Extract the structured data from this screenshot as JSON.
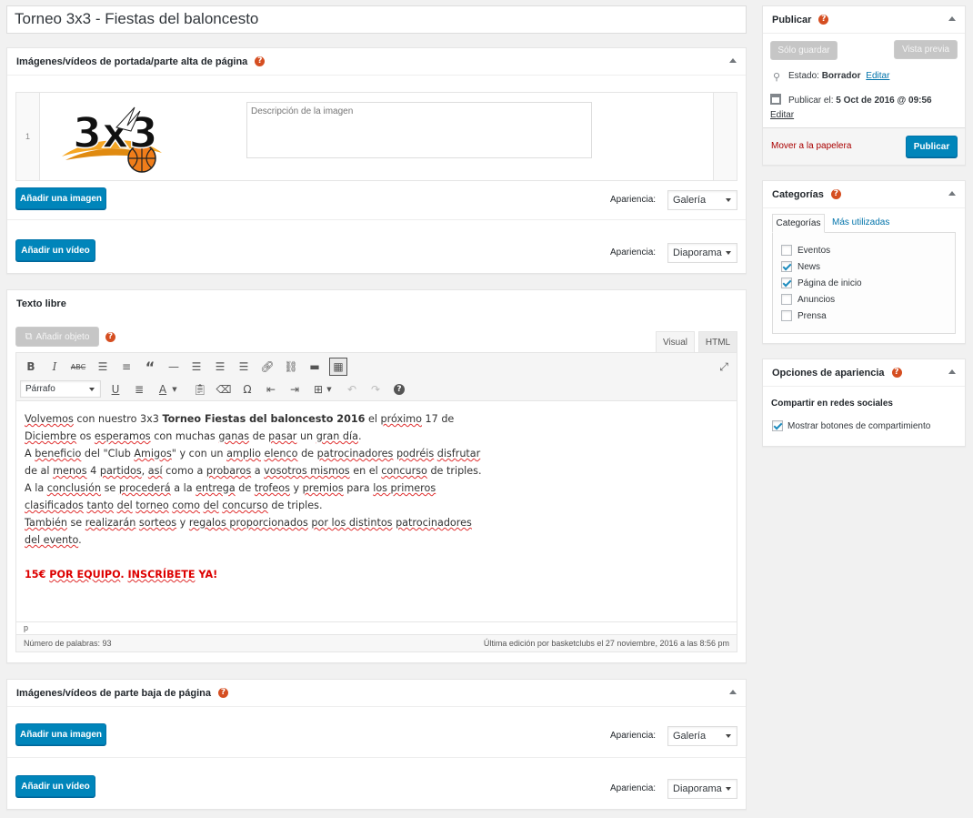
{
  "post_title": "Torneo 3x3 - Fiestas del baloncesto",
  "top_media": {
    "title": "Imágenes/vídeos de portada/parte alta de página",
    "row_number": "1",
    "logo_text": "3x3",
    "description_placeholder": "Descripción de la imagen",
    "add_image_label": "Añadir una imagen",
    "appearance_label": "Apariencia:",
    "image_appearance": "Galería",
    "add_video_label": "Añadir un vídeo",
    "video_appearance": "Diaporama"
  },
  "free_text": {
    "title": "Texto libre",
    "add_object_label": "Añadir objeto",
    "tab_visual": "Visual",
    "tab_html": "HTML",
    "format_select": "Párrafo",
    "path": "p",
    "word_count": "Número de palabras: 93",
    "last_edit": "Última edición por basketclubs el 27 noviembre, 2016 a las 8:56 pm",
    "content": {
      "l1a": "Volvemos",
      "l1b": " con nuestro 3x3 ",
      "l1c": "Torneo Fiestas del baloncesto 2016",
      "l1d": " el ",
      "l1e": "próximo",
      "l1f": " 17 de",
      "l2a": "Diciembre",
      "l2b": " os ",
      "l2c": "esperamos",
      "l2d": " con muchas ",
      "l2e": "ganas",
      "l2f": " de ",
      "l2g": "pasar",
      "l2h": " un ",
      "l2i": "gran día",
      "l2j": ".",
      "l3a": "A ",
      "l3b": "beneficio",
      "l3c": " del \"Club ",
      "l3d": "Amigos",
      "l3e": "\" y con un ",
      "l3f": "amplio",
      "l3g": " ",
      "l3h": "elenco",
      "l3i": " de ",
      "l3j": "patrocinadores",
      "l3k": " ",
      "l3l": "podréis",
      "l3m": " ",
      "l3n": "disfrutar",
      "l4a": "de al ",
      "l4b": "menos",
      "l4c": " 4 ",
      "l4d": "partidos",
      "l4e": ", ",
      "l4f": "así",
      "l4g": " como a ",
      "l4h": "probaros",
      "l4i": " a ",
      "l4j": "vosotros mismos",
      "l4k": " en el ",
      "l4l": "concurso",
      "l4m": " de triples.",
      "l5a": "A la ",
      "l5b": "conclusión",
      "l5c": " se ",
      "l5d": "procederá",
      "l5e": " a la ",
      "l5f": "entrega",
      "l5g": " de ",
      "l5h": "trofeos",
      "l5i": " y ",
      "l5j": "premios",
      "l5k": " para ",
      "l5l": "los primeros",
      "l6a": "clasificados",
      "l6b": " ",
      "l6c": "tanto",
      "l6d": " ",
      "l6e": "del",
      "l6f": " ",
      "l6g": "torneo",
      "l6h": " ",
      "l6i": "como",
      "l6j": " ",
      "l6k": "del",
      "l6l": " ",
      "l6m": "concurso",
      "l6n": " de triples.",
      "l7a": "También",
      "l7b": " se ",
      "l7c": "realizarán",
      "l7d": " ",
      "l7e": "sorteos",
      "l7f": " y ",
      "l7g": "regalos proporcionados",
      "l7h": " ",
      "l7i": "por los distintos",
      "l7j": " ",
      "l7k": "patrocinadores",
      "l8a": "del evento",
      "l8b": ".",
      "l9a": "15€ ",
      "l9b": "POR EQUIPO",
      "l9c": ". ",
      "l9d": "INSCRÍBETE",
      "l9e": " YA!"
    }
  },
  "bottom_media": {
    "title": "Imágenes/vídeos de parte baja de página",
    "add_image_label": "Añadir una imagen",
    "appearance_label": "Apariencia:",
    "image_appearance": "Galería",
    "add_video_label": "Añadir un vídeo",
    "video_appearance": "Diaporama"
  },
  "publish": {
    "title": "Publicar",
    "save_draft": "Sólo guardar",
    "preview": "Vista previa",
    "status_label": "Estado: ",
    "status_value": "Borrador",
    "edit": "Editar",
    "publish_on_label": "Publicar el: ",
    "publish_on_value": "5 Oct de 2016 @ 09:56",
    "trash": "Mover a la papelera",
    "publish_button": "Publicar"
  },
  "categories": {
    "title": "Categorías",
    "tab_all": "Categorías",
    "tab_popular": "Más utilizadas",
    "items": [
      {
        "label": "Eventos",
        "checked": false
      },
      {
        "label": "News",
        "checked": true
      },
      {
        "label": "Página de inicio",
        "checked": true
      },
      {
        "label": "Anuncios",
        "checked": false
      },
      {
        "label": "Prensa",
        "checked": false
      }
    ]
  },
  "appearance_options": {
    "title": "Opciones de apariencia",
    "section": "Compartir en redes sociales",
    "share_label": "Mostrar botones de compartimiento",
    "share_checked": true
  },
  "colors": {
    "primary": "#0085ba",
    "help": "#d54e21",
    "trash": "#a00",
    "link": "#0073aa"
  }
}
